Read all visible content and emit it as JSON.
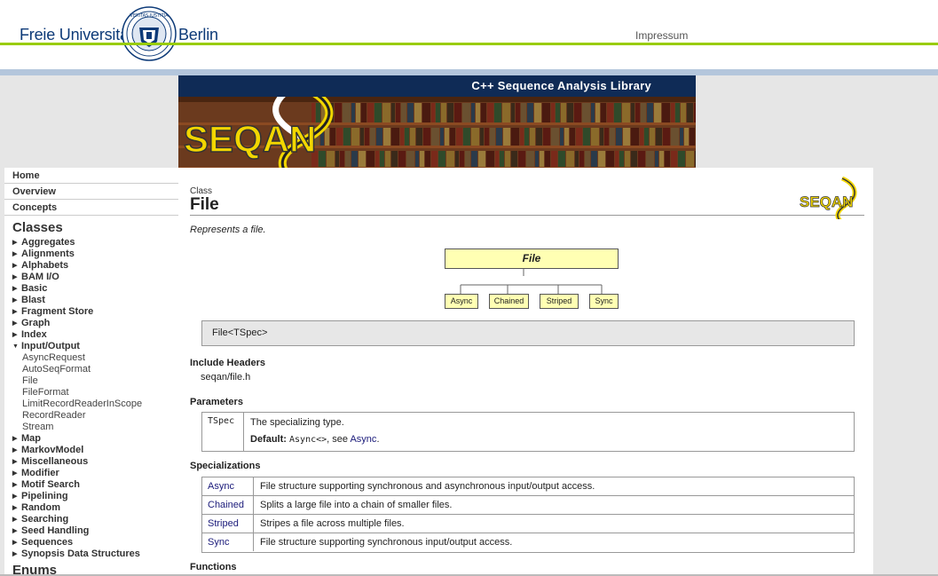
{
  "header": {
    "university_left": "Freie Universität",
    "university_right": "Berlin",
    "impressum": "Impressum"
  },
  "banner": {
    "title": "C++ Sequence Analysis Library",
    "logo_text": "SEQAN"
  },
  "sidebar": {
    "nav": [
      "Home",
      "Overview",
      "Concepts"
    ],
    "classes_heading": "Classes",
    "categories_before": [
      "Aggregates",
      "Alignments",
      "Alphabets",
      "BAM I/O",
      "Basic",
      "Blast",
      "Fragment Store",
      "Graph",
      "Index"
    ],
    "expanded_category": "Input/Output",
    "expanded_items": [
      "AsyncRequest",
      "AutoSeqFormat",
      "File",
      "FileFormat",
      "LimitRecordReaderInScope",
      "RecordReader",
      "Stream"
    ],
    "categories_after": [
      "Map",
      "MarkovModel",
      "Miscellaneous",
      "Modifier",
      "Motif Search",
      "Pipelining",
      "Random",
      "Searching",
      "Seed Handling",
      "Sequences",
      "Synopsis Data Structures"
    ],
    "next_heading": "Enums"
  },
  "main": {
    "kicker": "Class",
    "title": "File",
    "summary": "Represents a file.",
    "logo_text": "SEQAN",
    "diagram": {
      "root": "File",
      "children": [
        "Async",
        "Chained",
        "Striped",
        "Sync"
      ]
    },
    "signature": "File<TSpec>",
    "include_heading": "Include Headers",
    "include_file": "seqan/file.h",
    "parameters_heading": "Parameters",
    "parameter": {
      "name": "TSpec",
      "description": "The specializing type.",
      "default_label": "Default:",
      "default_code": "Async<>",
      "default_see": ", see ",
      "default_link": "Async",
      "default_end": "."
    },
    "specializations_heading": "Specializations",
    "specializations": [
      {
        "name": "Async",
        "description": "File structure supporting synchronous and asynchronous input/output access."
      },
      {
        "name": "Chained",
        "description": "Splits a large file into a chain of smaller files."
      },
      {
        "name": "Striped",
        "description": "Stripes a file across multiple files."
      },
      {
        "name": "Sync",
        "description": "File structure supporting synchronous input/output access."
      }
    ],
    "functions_heading": "Functions"
  },
  "colors": {
    "fu_blue": "#0d3a78",
    "fu_green": "#99cc00",
    "banner_navy": "#0f2b56",
    "seqan_yellow": "#f2d600",
    "diagram_fill": "#ffffb3",
    "link": "#1a1a7a"
  }
}
